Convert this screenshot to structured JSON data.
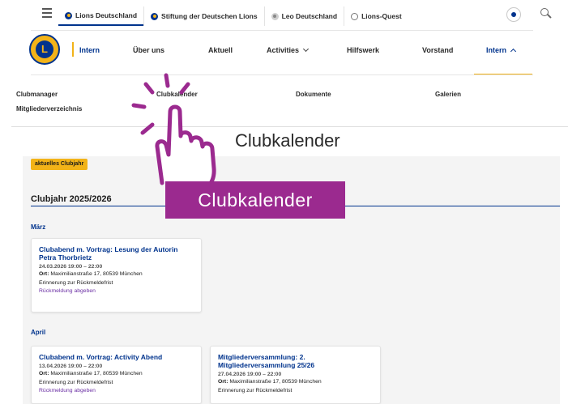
{
  "topbar": {
    "tabs": [
      {
        "label": "Lions Deutschland",
        "icon": "lions-logo-icon"
      },
      {
        "label": "Stiftung der Deutschen Lions",
        "icon": "lions-logo-icon"
      },
      {
        "label": "Leo Deutschland",
        "icon": "leo-logo-icon"
      },
      {
        "label": "Lions-Quest",
        "icon": "lions-quest-logo-icon"
      }
    ]
  },
  "brand": {
    "label": "Intern",
    "logo_text": "L"
  },
  "mainnav": {
    "items": [
      "Über uns",
      "Aktuell",
      "Activities",
      "Hilfswerk",
      "Vorstand",
      "Intern"
    ]
  },
  "subnav": {
    "items": [
      "Clubmanager",
      "Clubkalender",
      "Dokumente",
      "Galerien",
      "Mitgliederverzeichnis"
    ]
  },
  "page": {
    "title": "Clubkalender"
  },
  "content": {
    "badge": "aktuelles Clubjahr",
    "year_heading": "Clubjahr 2025/2026",
    "months": [
      {
        "label": "März",
        "events": [
          {
            "title": "Clubabend m. Vortrag: Lesung der Autorin Petra Thorbrietz",
            "date": "24.03.2026 19:00 – 22:00",
            "location_label": "Ort:",
            "location": "Maximilianstraße 17, 80539 München",
            "reminder": "Erinnerung zur Rückmeldefrist",
            "link": "Rückmeldung abgeben"
          }
        ]
      },
      {
        "label": "April",
        "events": [
          {
            "title": "Clubabend m. Vortrag: Activity Abend",
            "date": "13.04.2026 19:00 – 22:00",
            "location_label": "Ort:",
            "location": "Maximilianstraße 17, 80539 München",
            "reminder": "Erinnerung zur Rückmeldefrist",
            "link": "Rückmeldung abgeben"
          },
          {
            "title": "Mitgliederversammlung: 2. Mitgliederversammlung 25/26",
            "date": "27.04.2026 19:00 – 22:00",
            "location_label": "Ort:",
            "location": "Maximilianstraße 17, 80539 München",
            "reminder": "Erinnerung zur Rückmeldefrist"
          }
        ]
      }
    ]
  },
  "overlay": {
    "label": "Clubkalender"
  },
  "colors": {
    "brand_blue": "#00338d",
    "brand_gold": "#f2b318",
    "overlay_purple": "#9b2a8f",
    "link_purple": "#6a2ea3"
  }
}
